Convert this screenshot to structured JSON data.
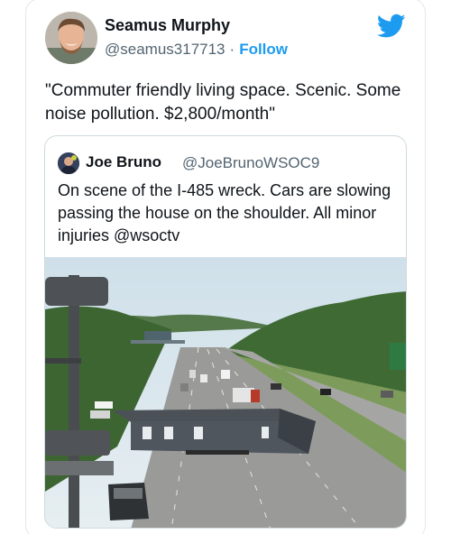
{
  "author": {
    "name": "Seamus Murphy",
    "handle": "@seamus317713",
    "separator": "·",
    "follow_label": "Follow"
  },
  "tweet": {
    "text": "\"Commuter friendly living space. Scenic. Some noise pollution. $2,800/month\""
  },
  "quoted_tweet": {
    "name": "Joe Bruno",
    "handle": "@JoeBrunoWSOC9",
    "text": "On scene of the I-485 wreck. Cars are slowing passing the house on the shoulder. All minor injuries @wsoctv"
  },
  "icons": {
    "brand": "twitter-bird-icon",
    "brand_color": "#1d9bf0"
  }
}
